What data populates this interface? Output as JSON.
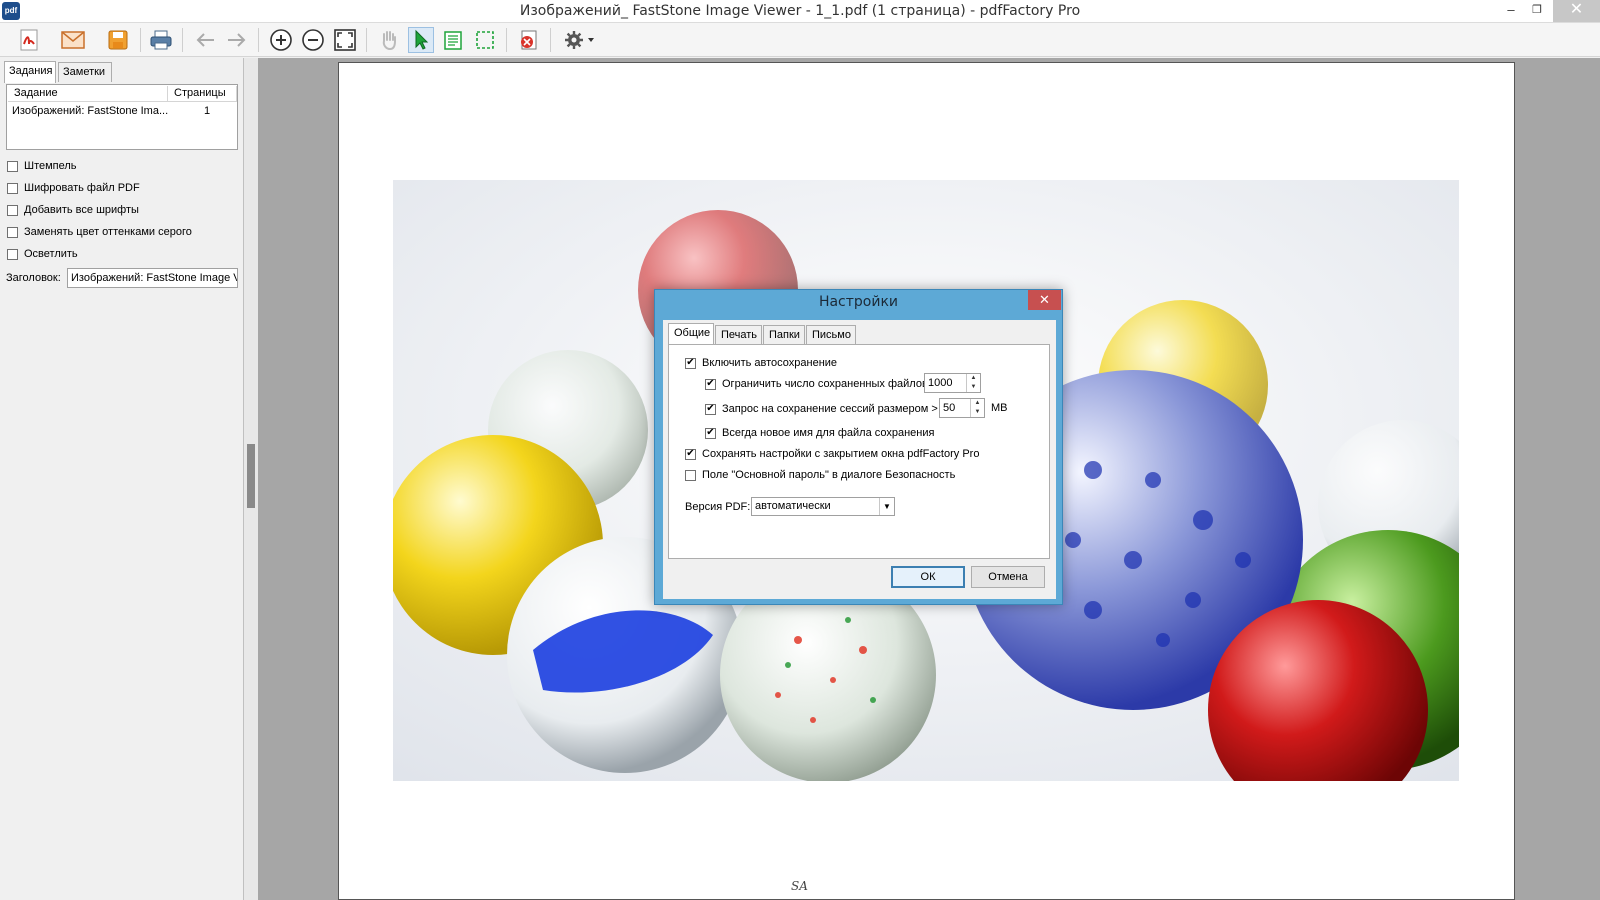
{
  "window": {
    "title": "Изображений_ FastStone Image Viewer - 1_1.pdf (1 страница) - pdfFactory Pro",
    "app_icon_text": "pdf",
    "minimize_glyph": "–",
    "maximize_glyph": "❐",
    "close_glyph": "✕"
  },
  "toolbar": {
    "buttons": [
      "save-pdf-icon",
      "email-icon",
      "save-icon",
      "print-icon",
      "back-arrow-icon",
      "forward-arrow-icon",
      "zoom-in-icon",
      "zoom-out-icon",
      "fit-page-icon",
      "hand-tool-icon",
      "select-arrow-icon",
      "text-select-icon",
      "snapshot-icon",
      "delete-page-icon",
      "settings-gear-icon"
    ]
  },
  "left_panel": {
    "tabs": [
      "Задания",
      "Заметки"
    ],
    "active_tab": "Задания",
    "jobs_table": {
      "columns": [
        "Задание",
        "Страницы"
      ],
      "rows": [
        {
          "name": "Изображений: FastStone Ima...",
          "pages": "1"
        }
      ]
    },
    "options": [
      {
        "label": "Штемпель",
        "checked": false
      },
      {
        "label": "Шифровать файл PDF",
        "checked": false
      },
      {
        "label": "Добавить все шрифты",
        "checked": false
      },
      {
        "label": "Заменять цвет оттенками серого",
        "checked": false
      },
      {
        "label": "Осветлить",
        "checked": false
      }
    ],
    "title_label": "Заголовок:",
    "title_value": "Изображений: FastStone Image V"
  },
  "document": {
    "footer_mark": "SA"
  },
  "dialog": {
    "title": "Настройки",
    "tabs": [
      "Общие",
      "Печать",
      "Папки",
      "Письмо"
    ],
    "active_tab": "Общие",
    "options": {
      "autosave": {
        "label": "Включить автосохранение",
        "checked": true
      },
      "limit_files": {
        "label": "Ограничить число сохраненных файлов",
        "checked": true,
        "value": "1000"
      },
      "ask_session": {
        "label": "Запрос на сохранение сессий размером >",
        "checked": true,
        "value": "50",
        "unit": "МВ"
      },
      "new_name": {
        "label": "Всегда новое имя для файла сохранения",
        "checked": true
      },
      "save_settings": {
        "label": "Сохранять настройки с закрытием окна pdfFactory Pro",
        "checked": true
      },
      "master_password": {
        "label": "Поле \"Основной пароль\" в диалоге Безопасность",
        "checked": false
      }
    },
    "pdf_version_label": "Версия PDF:",
    "pdf_version_value": "автоматически",
    "ok_label": "ОК",
    "cancel_label": "Отмена"
  },
  "colors": {
    "dialog_frame": "#5da9d6",
    "close_button": "#c75050",
    "viewer_background": "#a6a6a6"
  }
}
